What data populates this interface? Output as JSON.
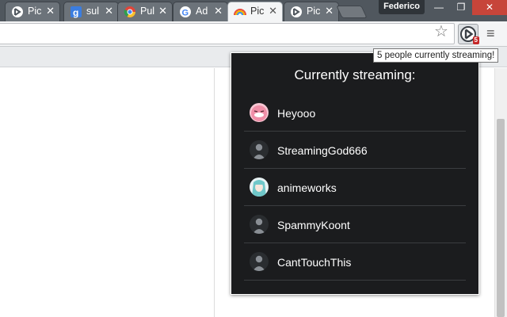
{
  "tabs": [
    {
      "title": "Pic",
      "icon": "picarto-icon"
    },
    {
      "title": "sul",
      "icon": "google-g-icon"
    },
    {
      "title": "Pul",
      "icon": "chrome-icon"
    },
    {
      "title": "Ad",
      "icon": "google-icon"
    },
    {
      "title": "Pic",
      "icon": "rainbow-icon",
      "active": true
    },
    {
      "title": "Pic",
      "icon": "picarto-icon"
    }
  ],
  "tab_close_glyph": "✕",
  "user_name": "Federico",
  "window_buttons": [
    "—",
    "❐",
    "✕"
  ],
  "toolbar": {
    "star_glyph": "☆",
    "menu_glyph": "≡",
    "badge_count": "5"
  },
  "tooltip": "5 people currently streaming!",
  "popup": {
    "title": "Currently streaming:",
    "streamers": [
      {
        "name": "Heyooo",
        "avatar": "pink-face"
      },
      {
        "name": "StreamingGod666",
        "avatar": "default-person"
      },
      {
        "name": "animeworks",
        "avatar": "anime-girl"
      },
      {
        "name": "SpammyKoont",
        "avatar": "default-person"
      },
      {
        "name": "CantTouchThis",
        "avatar": "default-person"
      }
    ]
  },
  "colors": {
    "popup_bg": "#1b1c1e",
    "titlebar": "#50575e",
    "badge": "#c62828"
  }
}
